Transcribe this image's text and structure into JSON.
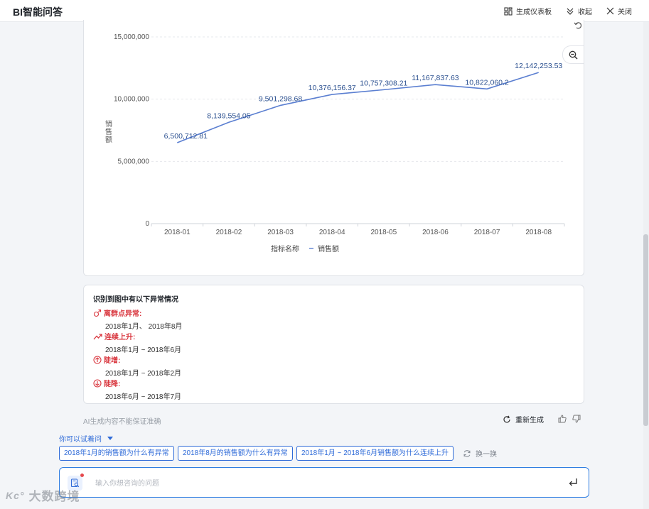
{
  "app": {
    "title": "BI智能问答"
  },
  "top_actions": {
    "dashboard": "生成仪表板",
    "collapse": "收起",
    "close": "关闭"
  },
  "chart_data": {
    "type": "line",
    "categories": [
      "2018-01",
      "2018-02",
      "2018-03",
      "2018-04",
      "2018-05",
      "2018-06",
      "2018-07",
      "2018-08"
    ],
    "series": [
      {
        "name": "销售额",
        "values": [
          6500712.81,
          8139554.05,
          9501298.68,
          10376156.37,
          10757308.21,
          11167837.63,
          10822060.2,
          12142253.53
        ]
      }
    ],
    "value_labels": [
      "6,500,712.81",
      "8,139,554.05",
      "9,501,298.68",
      "10,376,156.37",
      "10,757,308.21",
      "11,167,837.63",
      "10,822,060.2",
      "12,142,253.53"
    ],
    "y_ticks": [
      "0",
      "5,000,000",
      "10,000,000",
      "15,000,000"
    ],
    "y_tick_values": [
      0,
      5000000,
      10000000,
      15000000
    ],
    "ylim": [
      0,
      15000000
    ],
    "ylabel": "销售额",
    "xlabel": "",
    "legend_title": "指标名称",
    "legend_position": "bottom-center",
    "grid": true,
    "color": "#5b7fd1"
  },
  "anomalies": {
    "title": "识别到图中有以下异常情况",
    "items": [
      {
        "type": "离群点异常:",
        "range": "2018年1月、 2018年8月",
        "icon": "outlier-icon"
      },
      {
        "type": "连续上升:",
        "range": "2018年1月 ~ 2018年6月",
        "icon": "trend-up-icon"
      },
      {
        "type": "陡增:",
        "range": "2018年1月 ~ 2018年2月",
        "icon": "surge-up-icon"
      },
      {
        "type": "陡降:",
        "range": "2018年6月 ~ 2018年7月",
        "icon": "surge-down-icon"
      }
    ],
    "accent": "#d9363e"
  },
  "footer": {
    "disclaimer": "AI生成内容不能保证准确",
    "regenerate": "重新生成"
  },
  "suggestions": {
    "label": "你可以试着问",
    "chips": [
      "2018年1月的销售额为什么有异常",
      "2018年8月的销售额为什么有异常",
      "2018年1月 ~ 2018年6月销售额为什么连续上升"
    ],
    "swap": "换一换"
  },
  "input": {
    "placeholder": "输入你想咨询的问题"
  },
  "watermark": {
    "logo": "Kc°",
    "text": "大数跨境"
  }
}
